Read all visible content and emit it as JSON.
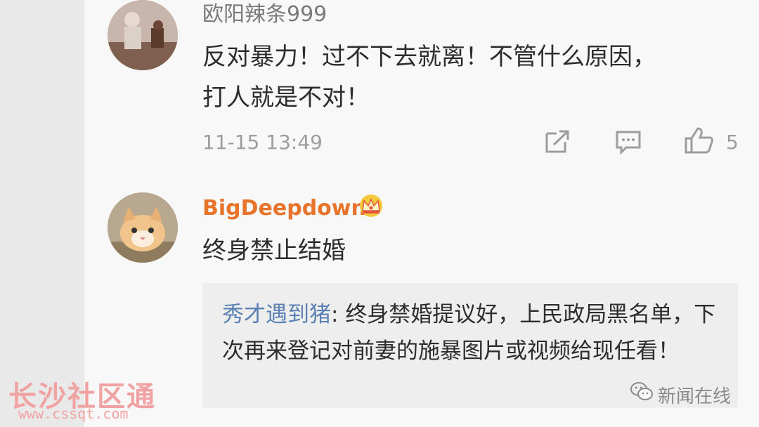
{
  "comments": [
    {
      "username": "欧阳辣条999",
      "text_lines": [
        "反对暴力！过不下去就离！不管什么原因，",
        "打人就是不对！"
      ],
      "timestamp": "11-15 13:49",
      "likes": "5"
    },
    {
      "username": "BigDeepdown",
      "text": "终身禁止结婚",
      "badge": "crown-icon",
      "reply": {
        "author": "秀才遇到猪",
        "separator": ": ",
        "text": "终身禁婚提议好，上民政局黑名单，下次再来登记对前妻的施暴图片或视频给现任看！"
      }
    }
  ],
  "watermarks": {
    "site_name": "长沙社区通",
    "site_url": "www.cssqt.com",
    "brand": "新闻在线"
  },
  "colors": {
    "username_gray": "#7a7a7a",
    "username_orange": "#e8742c",
    "reply_author_blue": "#5b80b3",
    "meta_gray": "#9d9d9d"
  }
}
